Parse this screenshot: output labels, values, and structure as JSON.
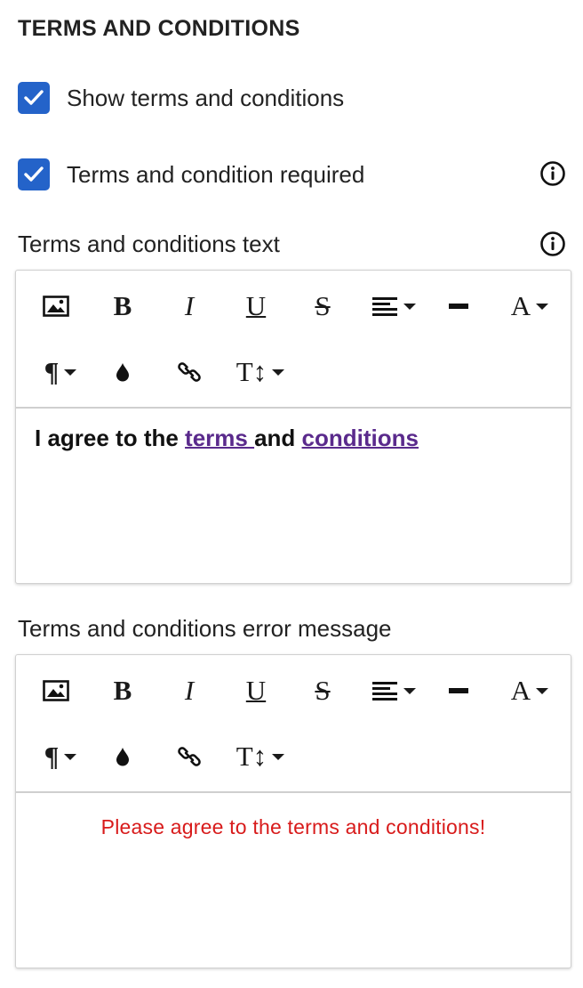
{
  "section": {
    "title": "TERMS AND CONDITIONS"
  },
  "checkboxes": [
    {
      "label": "Show terms and conditions",
      "checked": true
    },
    {
      "label": "Terms and condition required",
      "checked": true
    }
  ],
  "terms_text": {
    "label": "Terms and conditions text",
    "content_prefix": "I agree to the ",
    "link1": "terms ",
    "content_middle": "and ",
    "link2": "conditions"
  },
  "error_message": {
    "label": "Terms and conditions error message",
    "content": "Please agree to the terms and conditions!"
  },
  "toolbar": {
    "bold": "B",
    "italic": "I",
    "underline": "U",
    "strikethrough": "S",
    "font_color": "A",
    "paragraph": "¶",
    "text_size": "T↕"
  },
  "colors": {
    "accent": "#2463c9",
    "link": "#5a2a8c",
    "error": "#d81b1b"
  }
}
